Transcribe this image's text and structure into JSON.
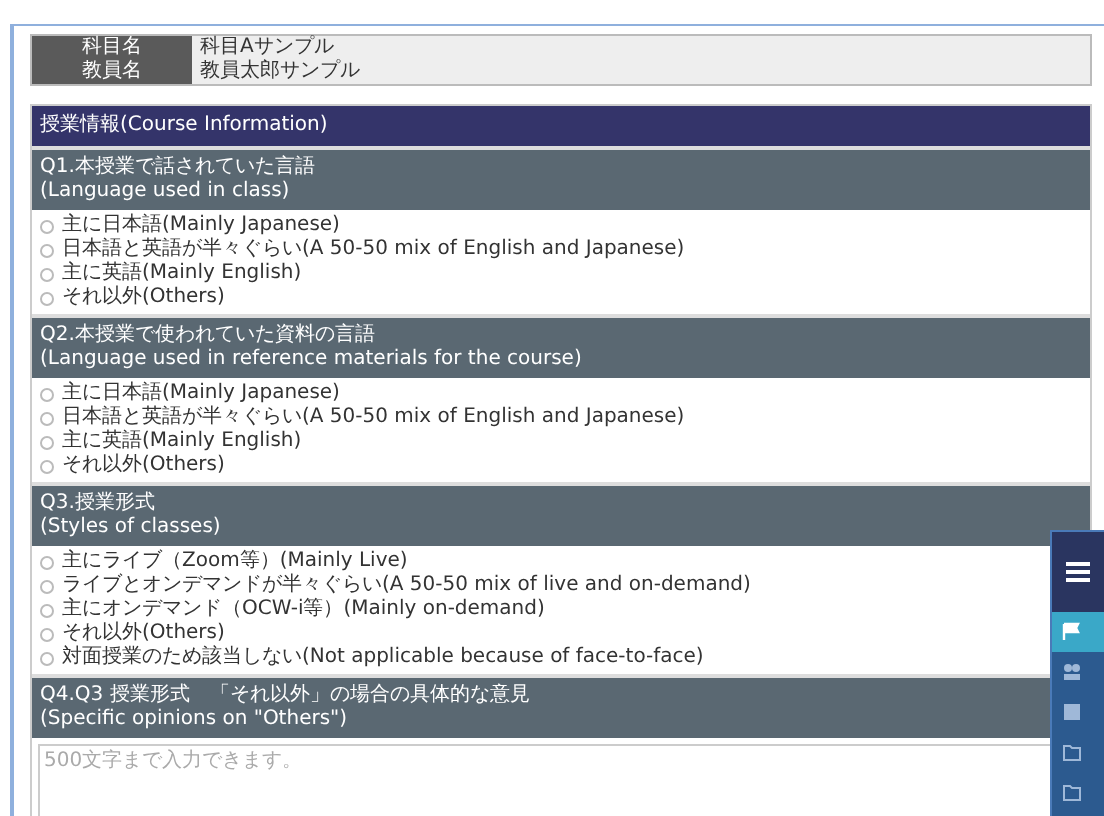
{
  "course_header": [
    {
      "label": "科目名",
      "value": "科目Aサンプル"
    },
    {
      "label": "教員名",
      "value": "教員太郎サンプル"
    }
  ],
  "section_title": "授業情報(Course Information)",
  "questions": [
    {
      "kind": "choice",
      "title": "Q1.本授業で話されていた言語",
      "subtitle": "(Language used in class)",
      "options": [
        {
          "label": "主に日本語(Mainly Japanese)",
          "selected": false
        },
        {
          "label": "日本語と英語が半々ぐらい(A 50-50 mix of English and Japanese)",
          "selected": false
        },
        {
          "label": "主に英語(Mainly English)",
          "selected": false
        },
        {
          "label": "それ以外(Others)",
          "selected": false
        }
      ]
    },
    {
      "kind": "choice",
      "title": "Q2.本授業で使われていた資料の言語",
      "subtitle": "(Language used in reference materials for the course)",
      "options": [
        {
          "label": "主に日本語(Mainly Japanese)",
          "selected": false
        },
        {
          "label": "日本語と英語が半々ぐらい(A 50-50 mix of English and Japanese)",
          "selected": false
        },
        {
          "label": "主に英語(Mainly English)",
          "selected": false
        },
        {
          "label": "それ以外(Others)",
          "selected": false
        }
      ]
    },
    {
      "kind": "choice",
      "title": "Q3.授業形式",
      "subtitle": "(Styles of classes)",
      "options": [
        {
          "label": "主にライブ（Zoom等）(Mainly Live)",
          "selected": false
        },
        {
          "label": "ライブとオンデマンドが半々ぐらい(A 50-50 mix of live and on-demand)",
          "selected": false
        },
        {
          "label": "主にオンデマンド（OCW-i等）(Mainly on-demand)",
          "selected": false
        },
        {
          "label": "それ以外(Others)",
          "selected": false
        },
        {
          "label": "対面授業のため該当しない(Not applicable because of face-to-face)",
          "selected": false
        }
      ]
    },
    {
      "kind": "text",
      "title": "Q4.Q3 授業形式　「それ以外」の場合の具体的な意見",
      "subtitle": "(Specific opinions on \"Others\")",
      "placeholder": "500文字まで入力できます。"
    }
  ],
  "side_menu": {
    "items": [
      {
        "kind": "flag",
        "selected": true
      },
      {
        "kind": "group",
        "selected": false
      },
      {
        "kind": "grid",
        "selected": false
      },
      {
        "kind": "folder",
        "selected": false
      },
      {
        "kind": "folder",
        "selected": false
      }
    ]
  }
}
